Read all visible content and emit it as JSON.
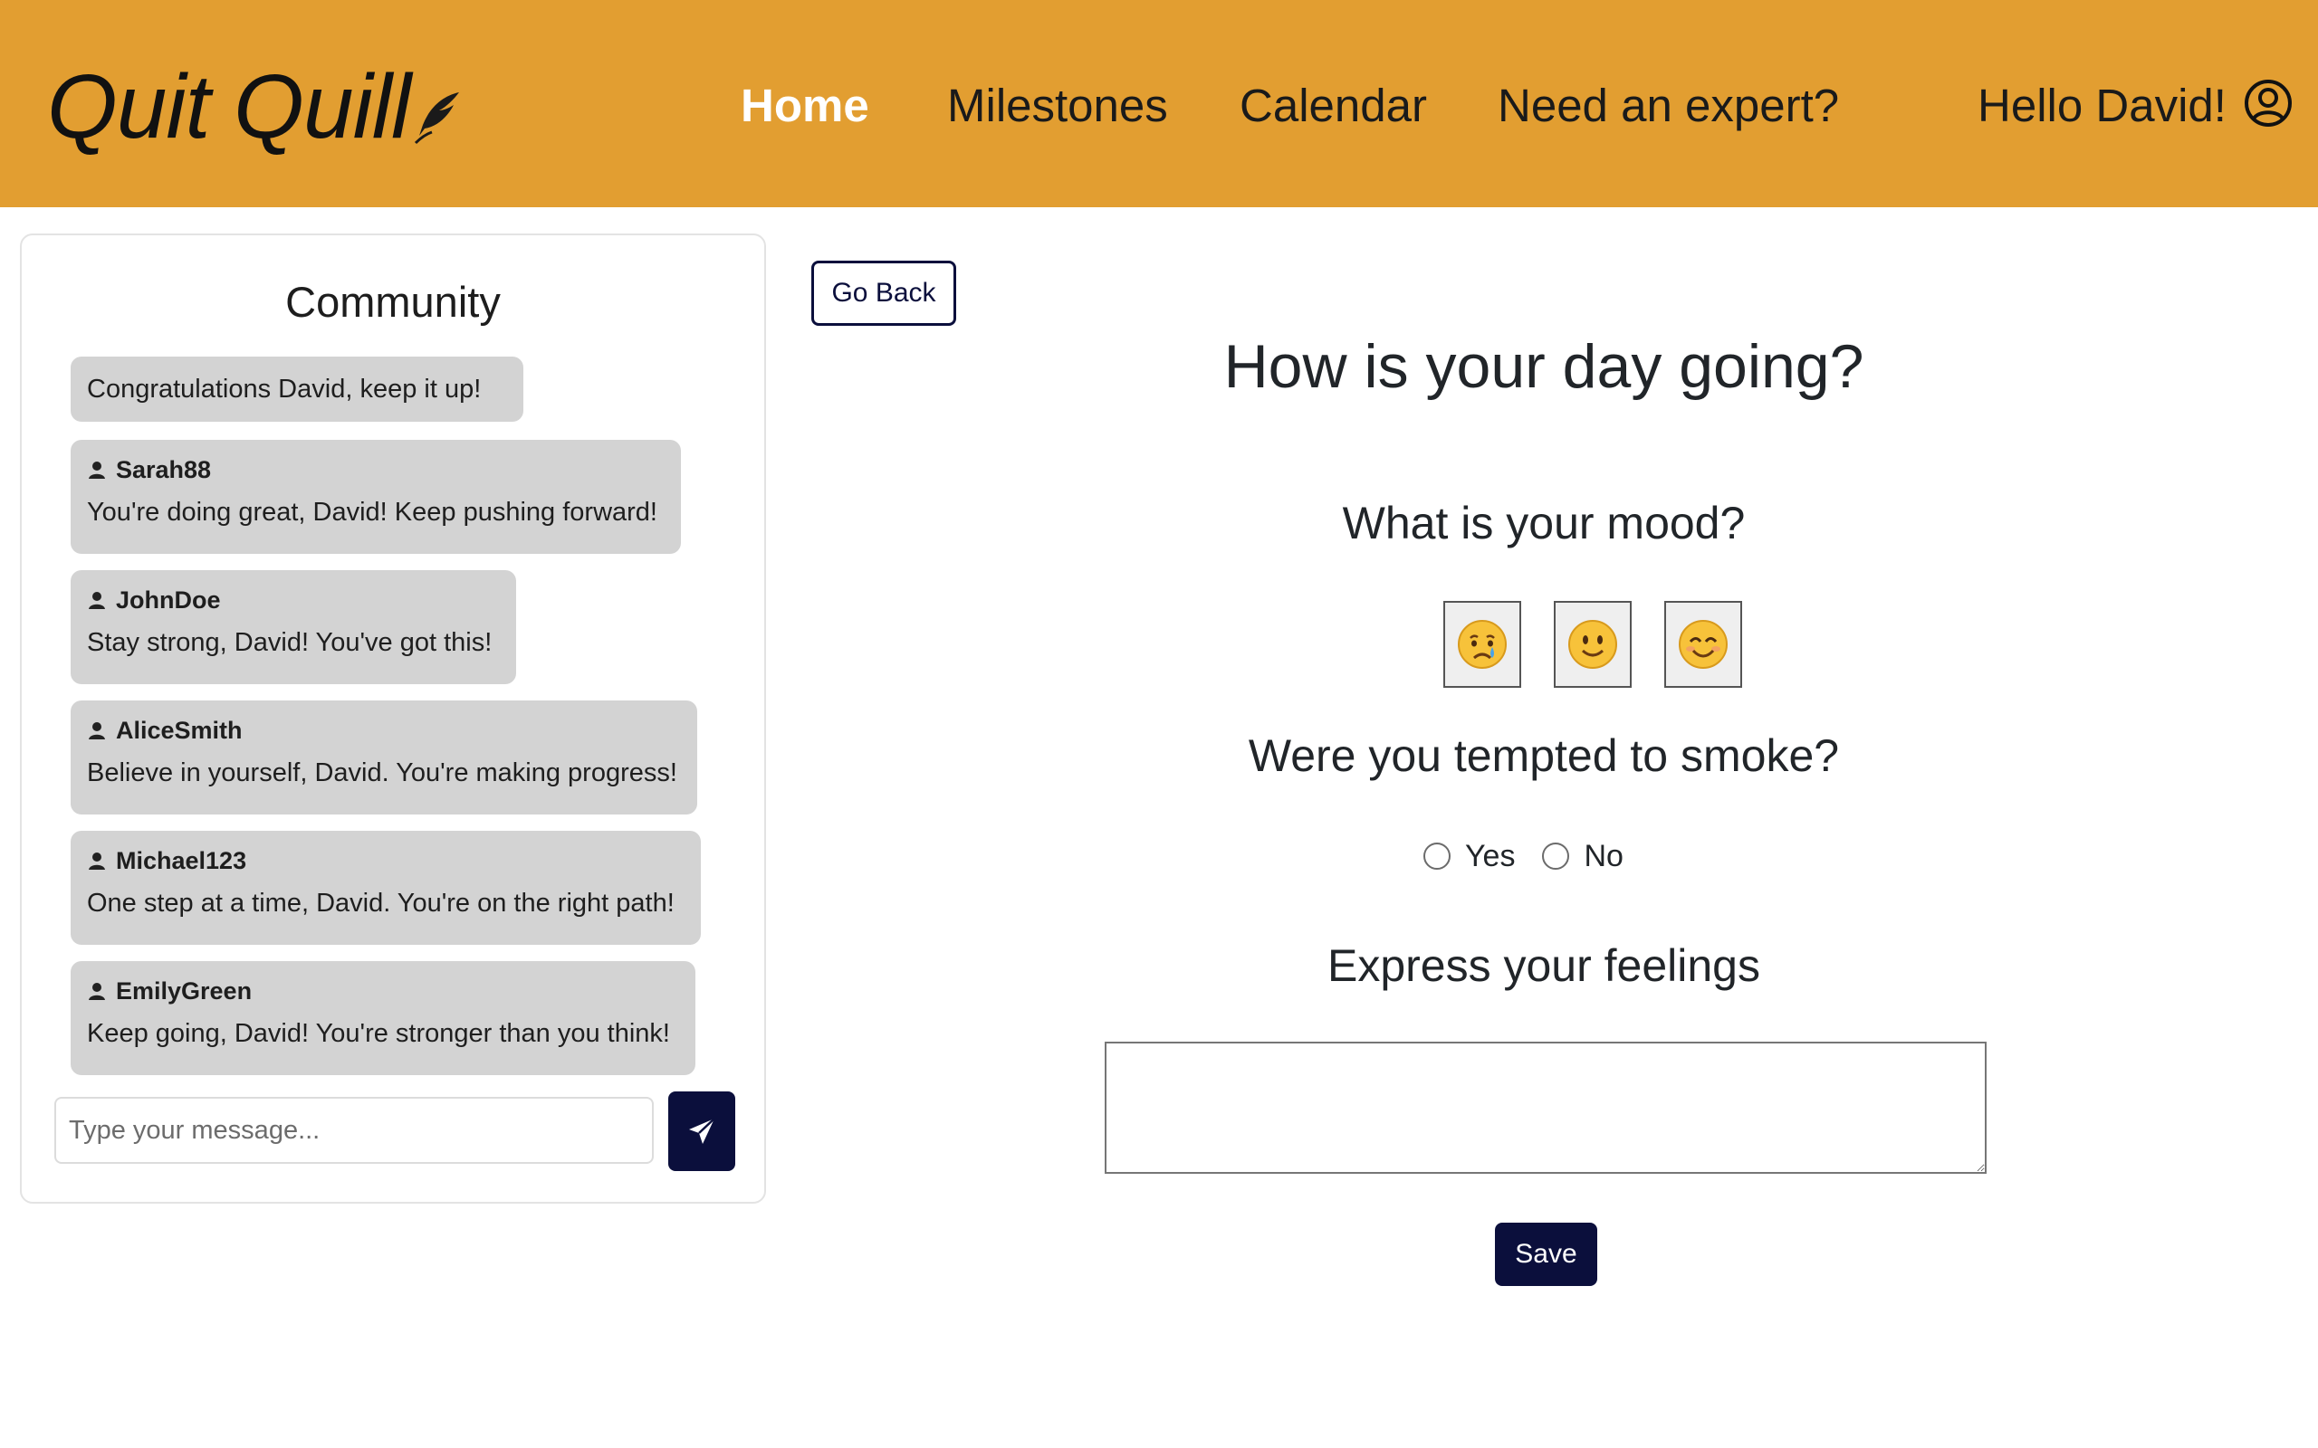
{
  "header": {
    "logo_text": "Quit Quill",
    "nav": [
      {
        "label": "Home",
        "active": true
      },
      {
        "label": "Milestones",
        "active": false
      },
      {
        "label": "Calendar",
        "active": false
      },
      {
        "label": "Need an expert?",
        "active": false
      }
    ],
    "greeting": "Hello David!",
    "user_icon": "user-circle-icon",
    "brand_color": "#e29e31"
  },
  "community": {
    "title": "Community",
    "messages": [
      {
        "author": "",
        "text": "Congratulations David, keep it up!"
      },
      {
        "author": "Sarah88",
        "text": "You're doing great, David! Keep pushing forward!"
      },
      {
        "author": "JohnDoe",
        "text": "Stay strong, David! You've got this!"
      },
      {
        "author": "AliceSmith",
        "text": "Believe in yourself, David. You're making progress!"
      },
      {
        "author": "Michael123",
        "text": "One step at a time, David. You're on the right path!"
      },
      {
        "author": "EmilyGreen",
        "text": "Keep going, David! You're stronger than you think!"
      }
    ],
    "input_placeholder": "Type your message...",
    "send_icon": "paper-plane-icon"
  },
  "main": {
    "go_back_label": "Go Back",
    "heading": "How is your day going?",
    "mood_question": "What is your mood?",
    "moods": [
      "😢",
      "🙂",
      "😊"
    ],
    "tempted_question": "Were you tempted to smoke?",
    "tempted_options": [
      "Yes",
      "No"
    ],
    "express_heading": "Express your feelings",
    "feelings_value": "",
    "save_label": "Save",
    "accent_color": "#0b0f3c"
  }
}
